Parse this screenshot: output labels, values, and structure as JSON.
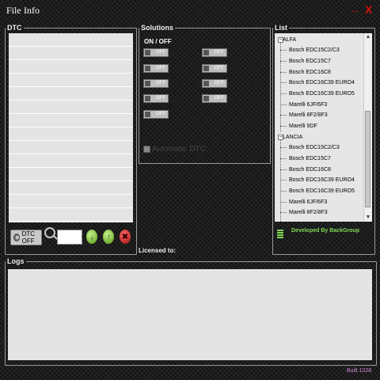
{
  "menu": {
    "file": "File",
    "info": "Info"
  },
  "window": {
    "minimize": "_",
    "close": "X"
  },
  "dtc": {
    "title": "DTC",
    "off_button": "DTC OFF",
    "rows": [
      "",
      "",
      "",
      "",
      "",
      "",
      "",
      "",
      "",
      "",
      "",
      "",
      "",
      ""
    ]
  },
  "solutions": {
    "title": "Solutions",
    "header": "ON  /  OFF",
    "toggle_label": "OFF",
    "automatic_dtc": "Automatic DTC"
  },
  "licensed_to": "Licensed to:",
  "list": {
    "title": "List",
    "groups": [
      {
        "name": "ALFA",
        "items": [
          "Bosch EDC15C2/C3",
          "Bosch EDC15C7",
          "Bosch EDC16C8",
          "Bosch EDC16C39 EURO4",
          "Bosch EDC16C39 EURO5",
          "Marelli 6JF/6F3",
          "Marelli 8F2/8F3",
          "Marelli 9DF"
        ]
      },
      {
        "name": "LANCIA",
        "items": [
          "Bosch EDC15C2/C3",
          "Bosch EDC15C7",
          "Bosch EDC16C8",
          "Bosch EDC16C39 EURO4",
          "Bosch EDC16C39 EURO5",
          "Marelli 6JF/6F3",
          "Marelli 8F2/8F3"
        ]
      }
    ]
  },
  "developed_by": "Developed By BackGroup",
  "logs": {
    "title": "Logs"
  },
  "build": "Built 1028",
  "colors": {
    "accent_green": "#7ed957",
    "close_red": "#d01010",
    "build_text": "#d28ad8"
  }
}
